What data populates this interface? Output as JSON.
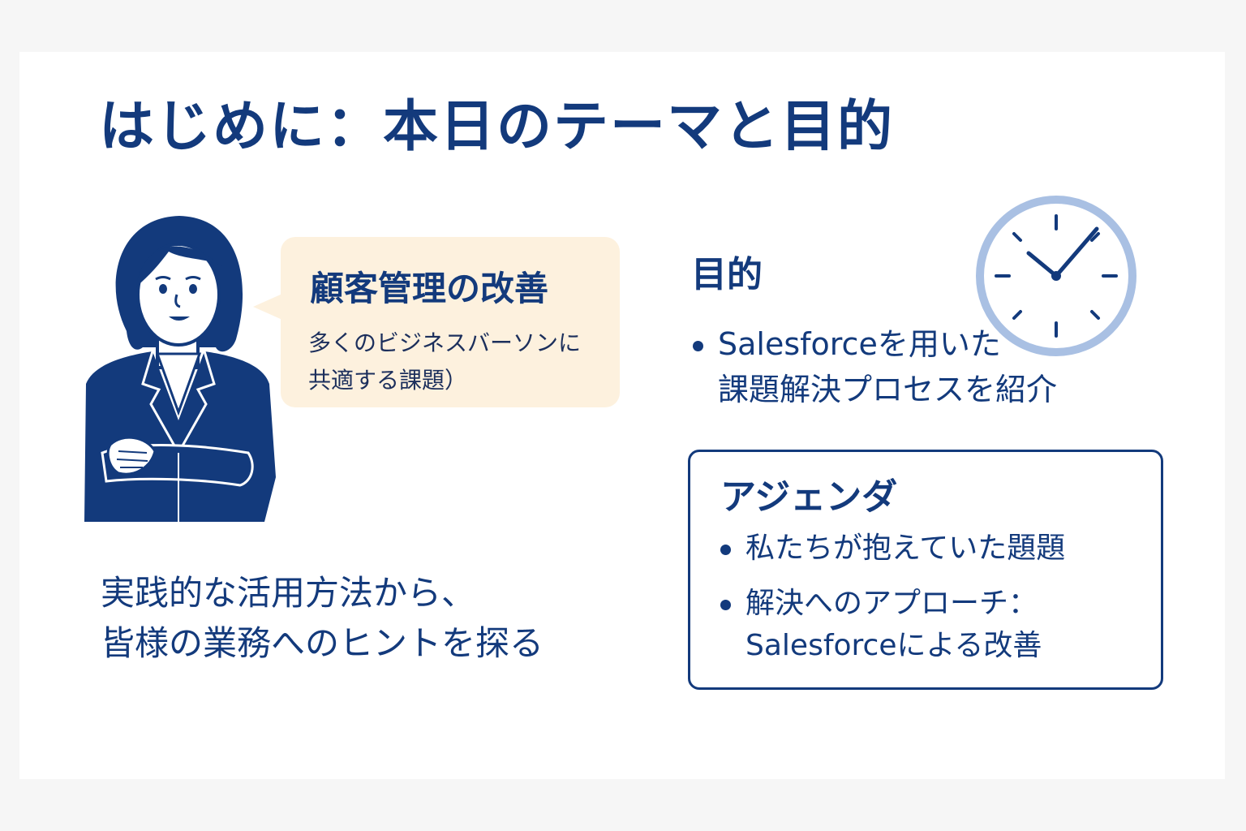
{
  "title": "はじめに：本日のテーマと目的",
  "bubble": {
    "title": "顧客管理の改善",
    "text_line1": "多くのビジネスバーソンに",
    "text_line2": "共適する課題）"
  },
  "bottom": {
    "line1": "実践的な活用方法から、",
    "line2": "皆様の業務へのヒントを探る"
  },
  "purpose": {
    "heading": "目的",
    "bullet_line1": "Salesforceを用いた",
    "bullet_line2": "課題解決プロセスを紹介"
  },
  "agenda": {
    "heading": "アジェンダ",
    "item1": "私たちが抱えていた題題",
    "item2_line1": "解決へのアプローチ：",
    "item2_line2": "Salesforceによる改善"
  },
  "icons": {
    "person": "businesswoman-arms-crossed-icon",
    "clock": "clock-icon"
  },
  "colors": {
    "navy": "#133a7c",
    "bubble_bg": "#fdf1de",
    "clock_rim": "#a9c0e3"
  }
}
